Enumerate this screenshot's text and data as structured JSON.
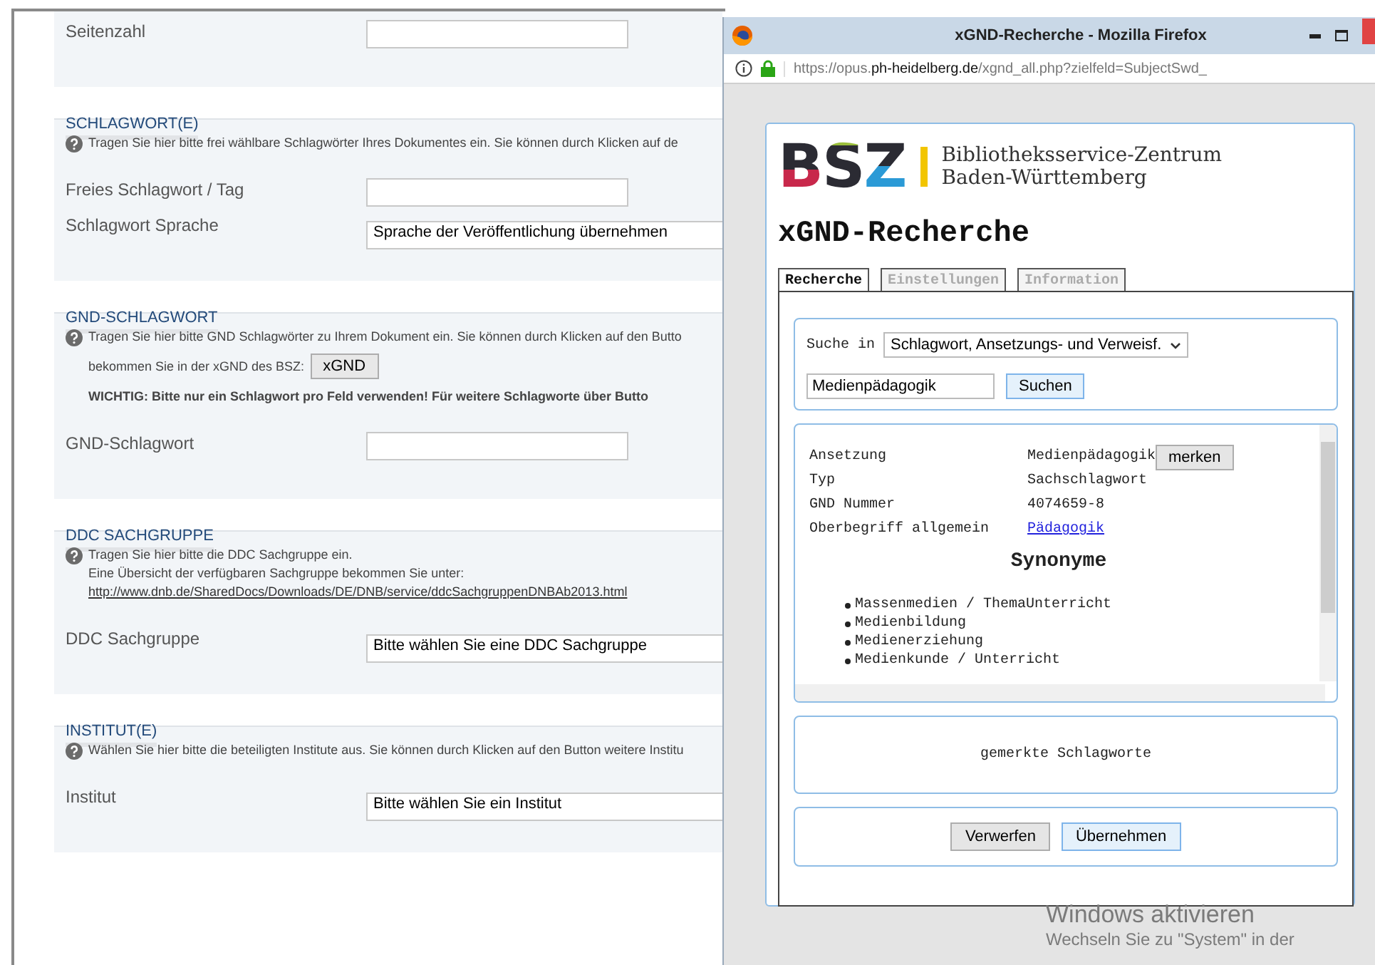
{
  "form": {
    "sections": [
      {
        "fields": [
          {
            "kind": "input",
            "label": "Seitenzahl"
          }
        ]
      },
      {
        "heading": "SCHLAGWORT(E)",
        "help": [
          {
            "kind": "text",
            "text": "Tragen Sie hier bitte frei wählbare Schlagwörter Ihres Dokumentes ein. Sie können durch Klicken auf de"
          }
        ],
        "fields": [
          {
            "kind": "input",
            "label": "Freies Schlagwort / Tag"
          },
          {
            "kind": "select",
            "label": "Schlagwort Sprache",
            "value": "Sprache der Veröffentlichung übernehmen"
          }
        ]
      },
      {
        "heading": "GND-SCHLAGWORT",
        "help": [
          {
            "kind": "text",
            "text": "Tragen Sie hier bitte GND Schlagwörter zu Ihrem Dokument ein. Sie können durch Klicken auf den Butto"
          },
          {
            "kind": "button",
            "text": "bekommen Sie in der xGND des BSZ:",
            "button": "xGND"
          },
          {
            "kind": "warning",
            "text": "WICHTIG: Bitte nur ein Schlagwort pro Feld verwenden! Für weitere Schlagworte über Butto"
          }
        ],
        "fields": [
          {
            "kind": "input",
            "label": "GND-Schlagwort"
          }
        ]
      },
      {
        "heading": "DDC SACHGRUPPE",
        "help": [
          {
            "kind": "text",
            "text": "Tragen Sie hier bitte die DDC Sachgruppe ein."
          },
          {
            "kind": "text",
            "text": "Eine Übersicht der verfügbaren Sachgruppe bekommen Sie unter:"
          },
          {
            "kind": "link",
            "text": "http://www.dnb.de/SharedDocs/Downloads/DE/DNB/service/ddcSachgruppenDNBAb2013.html"
          }
        ],
        "fields": [
          {
            "kind": "select",
            "label": "DDC Sachgruppe",
            "value": "Bitte wählen Sie eine DDC Sachgruppe"
          }
        ]
      },
      {
        "heading": "INSTITUT(E)",
        "help": [
          {
            "kind": "text",
            "text": "Wählen Sie hier bitte die beteiligten Institute aus. Sie können durch Klicken auf den Button weitere Institu"
          }
        ],
        "fields": [
          {
            "kind": "select",
            "label": "Institut",
            "value": "Bitte wählen Sie ein Institut"
          }
        ]
      }
    ]
  },
  "popup": {
    "title": "xGND-Recherche - Mozilla Firefox",
    "url": {
      "prefix": "https://opus.",
      "domain": "ph-heidelberg.de",
      "path": "/xgnd_all.php?zielfeld=SubjectSwd_"
    },
    "logo": {
      "letters": "BSZ",
      "line_1": "Bibliotheksservice-Zentrum",
      "line_2": "Baden-Württemberg"
    },
    "heading": "xGND-Recherche",
    "tabs": [
      {
        "label": "Recherche",
        "selected": true
      },
      {
        "label": "Einstellungen",
        "selected": false
      },
      {
        "label": "Information",
        "selected": false
      }
    ],
    "search": {
      "label": "Suche in",
      "scope": "Schlagwort, Ansetzungs- und Verweisf.",
      "query": "Medienpädagogik",
      "button": "Suchen"
    },
    "result": {
      "rows": [
        {
          "kind": "text",
          "key": "Ansetzung",
          "value": "Medienpädagogik",
          "button": "merken"
        },
        {
          "kind": "text",
          "key": "Typ",
          "value": "Sachschlagwort"
        },
        {
          "kind": "text",
          "key": "GND Nummer",
          "value": "4074659-8"
        },
        {
          "kind": "link",
          "key": "Oberbegriff allgemein",
          "value": "Pädagogik"
        }
      ],
      "synonyms_heading": "Synonyme",
      "synonyms": [
        "Massenmedien / ThemaUnterricht",
        "Medienbildung",
        "Medienerziehung",
        "Medienkunde / Unterricht"
      ]
    },
    "saved": "gemerkte Schlagworte",
    "buttons": [
      "Verwerfen",
      "Übernehmen"
    ]
  },
  "os_notice": [
    "Windows aktivieren",
    "Wechseln Sie zu \"System\" in der"
  ]
}
